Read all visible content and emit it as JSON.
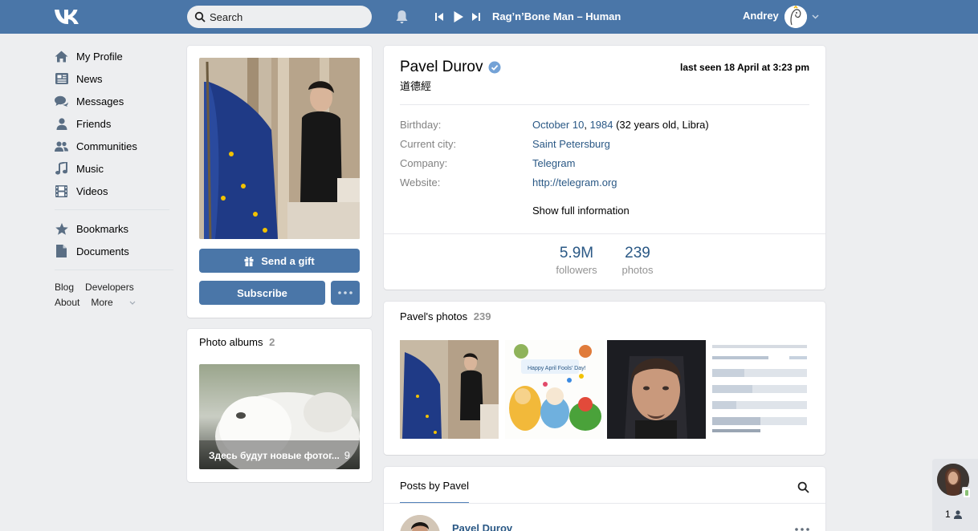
{
  "topbar": {
    "search_placeholder": "Search",
    "now_playing": "Rag’n’Bone Man – Human",
    "username": "Andrey"
  },
  "sidebar": {
    "items": [
      {
        "label": "My Profile",
        "icon": "home-icon"
      },
      {
        "label": "News",
        "icon": "news-icon"
      },
      {
        "label": "Messages",
        "icon": "messages-icon"
      },
      {
        "label": "Friends",
        "icon": "person-icon"
      },
      {
        "label": "Communities",
        "icon": "communities-icon"
      },
      {
        "label": "Music",
        "icon": "music-note-icon"
      },
      {
        "label": "Videos",
        "icon": "film-icon"
      }
    ],
    "items2": [
      {
        "label": "Bookmarks",
        "icon": "star-icon"
      },
      {
        "label": "Documents",
        "icon": "document-icon"
      }
    ],
    "footer": {
      "blog": "Blog",
      "developers": "Developers",
      "about": "About",
      "more": "More"
    }
  },
  "profile": {
    "send_gift": "Send a gift",
    "subscribe": "Subscribe",
    "albums_title": "Photo albums",
    "albums_count": "2",
    "album_name": "Здесь будут новые фотог...",
    "album_count": "9"
  },
  "info": {
    "name": "Pavel Durov",
    "status": "道德經",
    "last_seen": "last seen 18 April at 3:23 pm",
    "birthday_label": "Birthday:",
    "birthday_date": "October 10",
    "birthday_year": "1984",
    "birthday_extra": " (32 years old, Libra)",
    "city_label": "Current city:",
    "city": "Saint Petersburg",
    "company_label": "Company:",
    "company": "Telegram",
    "website_label": "Website:",
    "website": "http://telegram.org",
    "show_full": "Show full information",
    "followers_count": "5.9M",
    "followers_label": "followers",
    "photos_count": "239",
    "photos_label": "photos"
  },
  "photos": {
    "title": "Pavel's photos",
    "count": "239"
  },
  "posts": {
    "tab": "Posts by Pavel",
    "author": "Pavel Durov"
  },
  "chat_widget": {
    "count": "1"
  },
  "colors": {
    "header": "#4a76a8",
    "link": "#2a5885",
    "background": "#edeef0"
  }
}
